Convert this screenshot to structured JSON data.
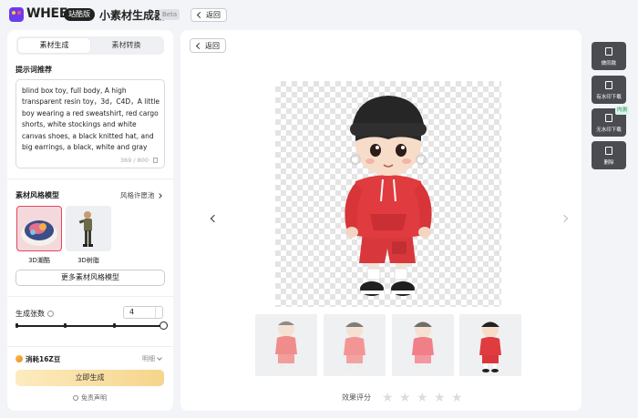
{
  "header": {
    "logo": "WHEE",
    "edition": "站酷版",
    "app_title": "小素材生成器",
    "beta": "Beta",
    "back_label": "返回"
  },
  "left": {
    "tabs": [
      "素材生成",
      "素材转换"
    ],
    "active_tab": 0,
    "prompt_section_title": "提示词推荐",
    "prompt_text": "blind box toy, full body, A high transparent resin toy，3d，C4D，A little boy wearing a red sweatshirt, red cargo shorts, white stockings and white canvas shoes, a black knitted hat, and big earrings, a black, white and gray color scheme, studio lighting, pastel colors",
    "prompt_count": "369 / 800",
    "style_section_title": "素材风格模型",
    "style_pool_link": "风格许愿池",
    "styles": [
      {
        "label": "3D潮酷",
        "selected": true
      },
      {
        "label": "3D树脂",
        "selected": false
      }
    ],
    "more_styles": "更多素材风格模型",
    "count_label": "生成张数",
    "count_value": "4",
    "slider_fraction": 1.0,
    "cost_label": "消耗16Z豆",
    "cost_more": "明细",
    "generate_button": "立即生成",
    "disclaimer": "免责声明"
  },
  "main": {
    "back_label": "返回",
    "rating_label": "效果评分",
    "rating_stars": 5,
    "selected_thumbnail": 3
  },
  "actions": [
    {
      "label": "做同款",
      "icon": "image-icon",
      "tag": ""
    },
    {
      "label": "有水印下载",
      "icon": "download-icon",
      "tag": ""
    },
    {
      "label": "无水印下载",
      "icon": "download-icon",
      "tag": "内测"
    },
    {
      "label": "删除",
      "icon": "trash-icon",
      "tag": ""
    }
  ],
  "colors": {
    "accent_dark": "#222222",
    "generate_gradient_start": "#fdebbf",
    "generate_gradient_end": "#f6d58b",
    "hoodie_red": "#e03b3f",
    "action_bg": "#4a4c52"
  }
}
